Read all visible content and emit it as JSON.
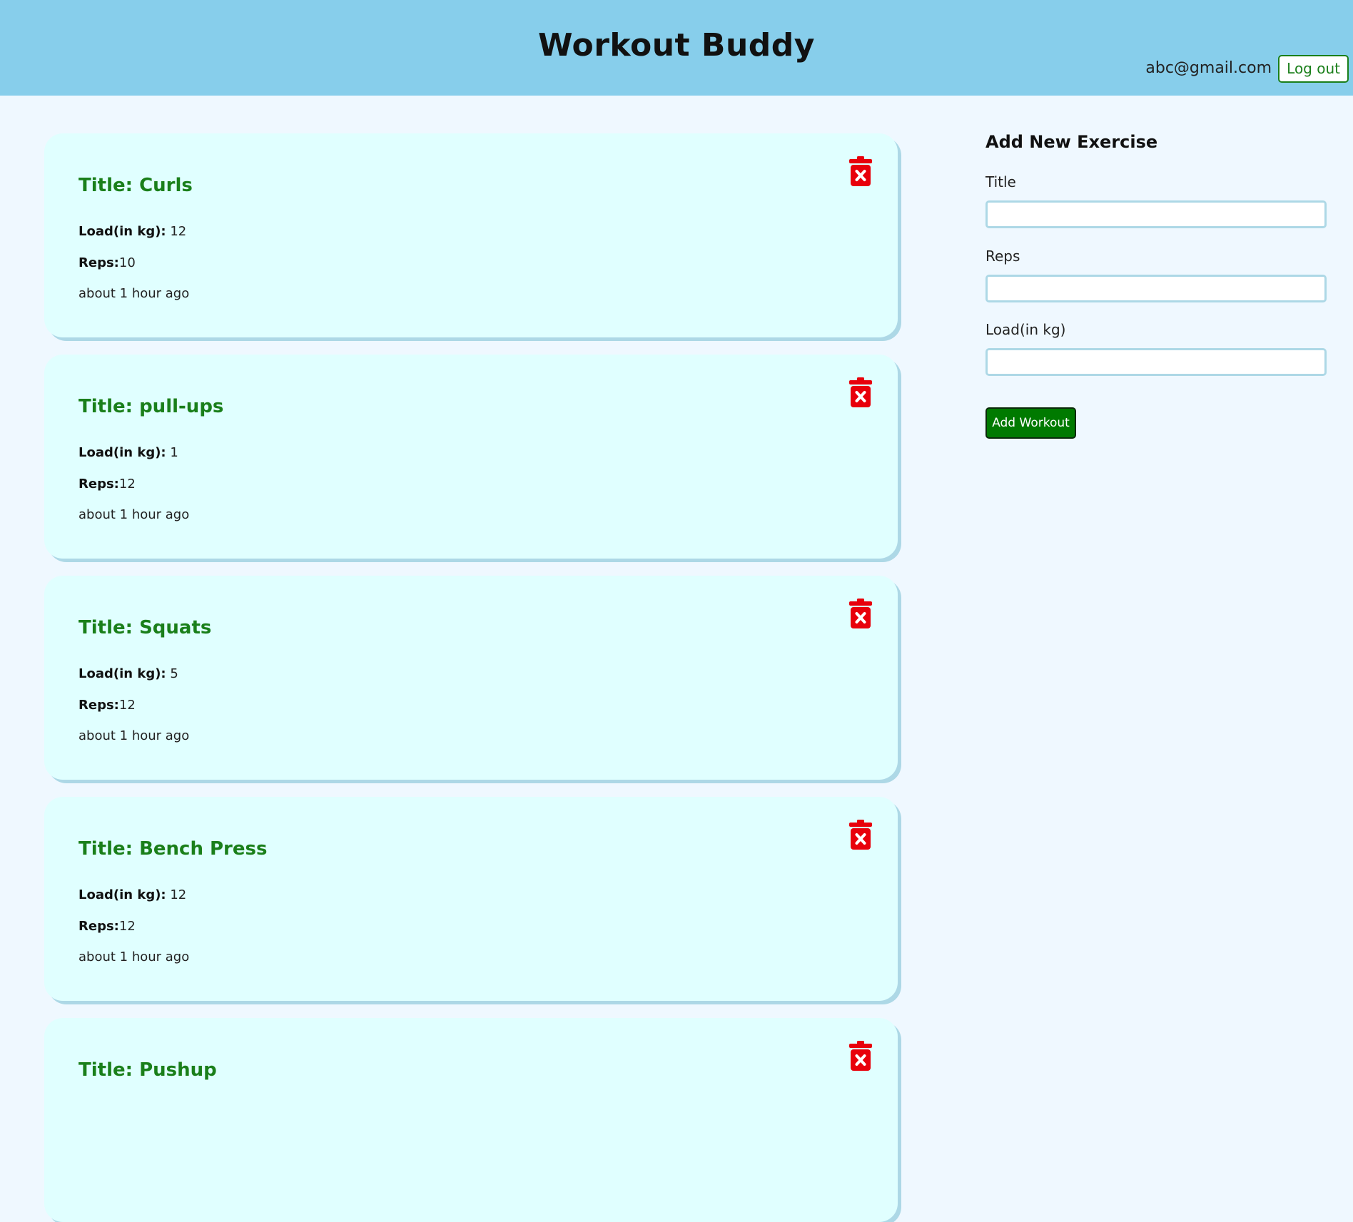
{
  "header": {
    "title": "Workout Buddy",
    "email": "abc@gmail.com",
    "logout_label": "Log out"
  },
  "labels": {
    "load": "Load(in kg):",
    "reps": "Reps:"
  },
  "workouts": [
    {
      "title": "Title: Curls",
      "load": " 12",
      "reps": "10",
      "time": "about 1 hour ago"
    },
    {
      "title": "Title: pull-ups",
      "load": " 1",
      "reps": "12",
      "time": "about 1 hour ago"
    },
    {
      "title": "Title: Squats",
      "load": " 5",
      "reps": "12",
      "time": "about 1 hour ago"
    },
    {
      "title": "Title: Bench Press",
      "load": " 12",
      "reps": "12",
      "time": "about 1 hour ago"
    },
    {
      "title": "Title: Pushup",
      "load": "",
      "reps": "",
      "time": ""
    }
  ],
  "form": {
    "heading": "Add New Exercise",
    "title_label": "Title",
    "title_value": "",
    "reps_label": "Reps",
    "reps_value": "",
    "load_label": "Load(in kg)",
    "load_value": "",
    "submit_label": "Add Workout"
  },
  "colors": {
    "header_bg": "#87ceeb",
    "page_bg": "#eff8ff",
    "card_bg": "#e0ffff",
    "title_green": "#1a7f1a",
    "delete_red": "#e8000b"
  },
  "icons": {
    "delete": "trash-x-icon"
  }
}
